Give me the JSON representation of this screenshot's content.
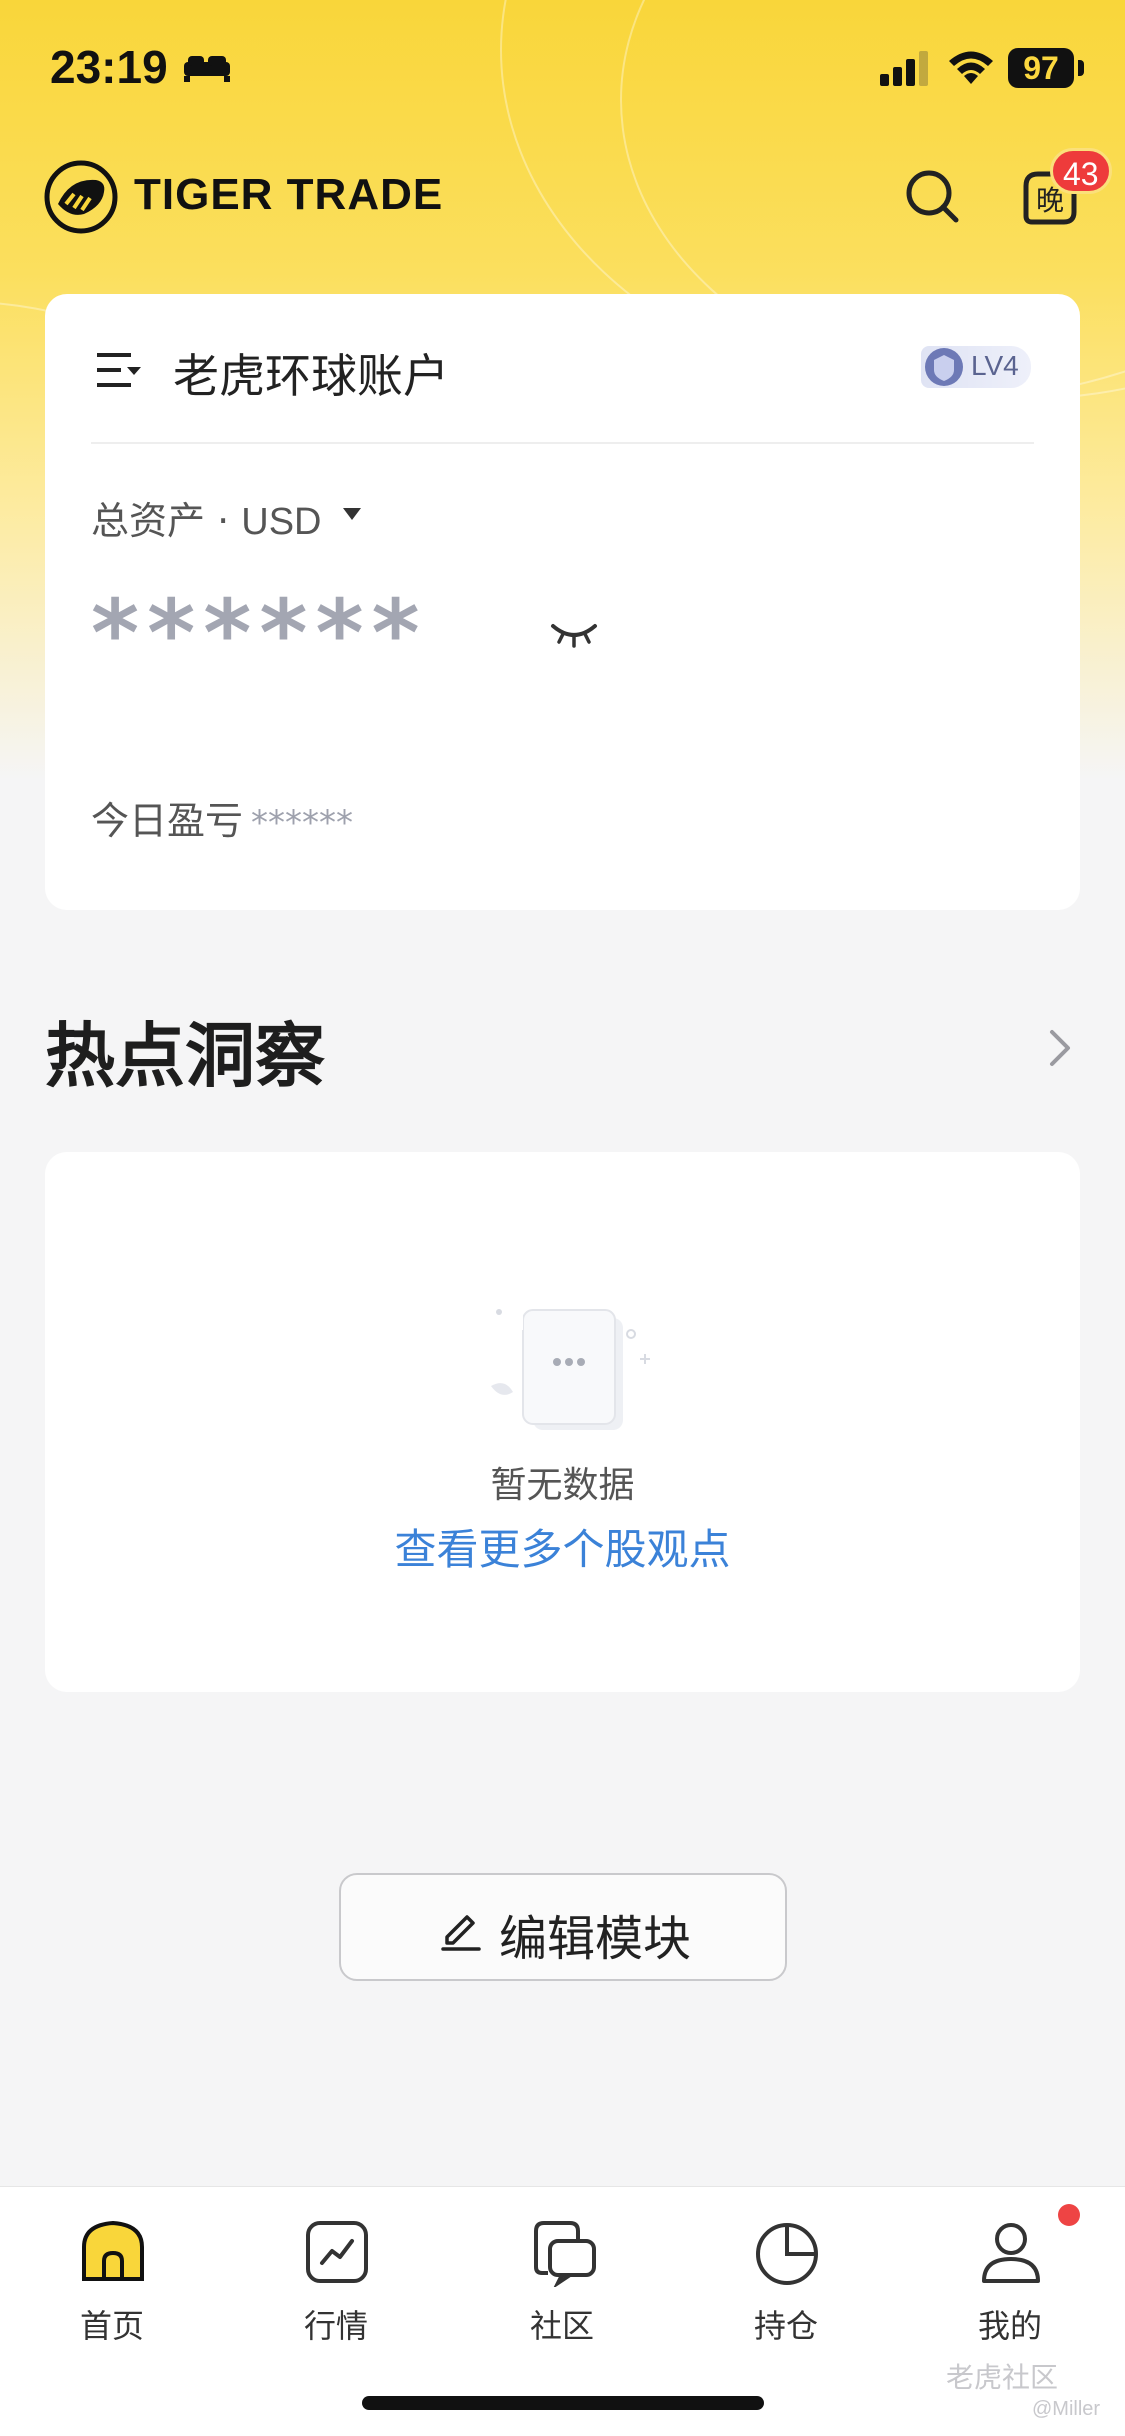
{
  "status_bar": {
    "time": "23:19",
    "battery": "97"
  },
  "header": {
    "brand": "TIGER TRADE",
    "evening_badge_count": "43",
    "evening_glyph": "晚"
  },
  "account": {
    "name": "老虎环球账户",
    "level": "LV4",
    "total_label": "总资产 · ",
    "currency": "USD",
    "masked_total": "******",
    "today_label": "今日盈亏",
    "today_masked": "******"
  },
  "insight": {
    "title": "热点洞察",
    "empty_text": "暂无数据",
    "link_text": "查看更多个股观点"
  },
  "edit": {
    "label": "编辑模块"
  },
  "tabs": [
    {
      "label": "首页",
      "icon": "home-icon",
      "active": true
    },
    {
      "label": "行情",
      "icon": "market-chart-icon",
      "active": false
    },
    {
      "label": "社区",
      "icon": "community-icon",
      "active": false
    },
    {
      "label": "持仓",
      "icon": "holdings-pie-icon",
      "active": false
    },
    {
      "label": "我的",
      "icon": "profile-icon",
      "active": false
    }
  ],
  "watermark": {
    "site": "老虎社区",
    "user": "@Miller"
  },
  "colors": {
    "brand_yellow": "#f9d63a",
    "link_blue": "#3b82d8",
    "badge_red": "#ee3b3b"
  }
}
